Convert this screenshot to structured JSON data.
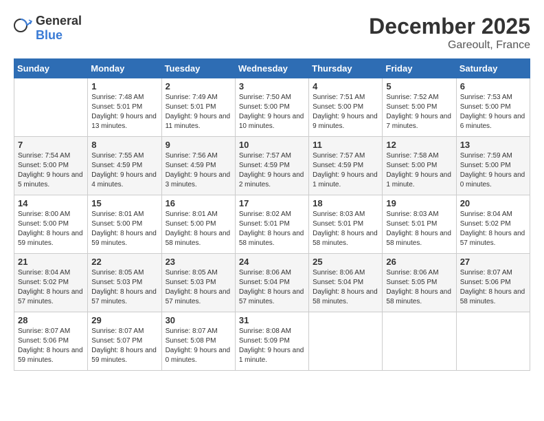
{
  "header": {
    "logo_general": "General",
    "logo_blue": "Blue",
    "month": "December 2025",
    "location": "Gareoult, France"
  },
  "days_of_week": [
    "Sunday",
    "Monday",
    "Tuesday",
    "Wednesday",
    "Thursday",
    "Friday",
    "Saturday"
  ],
  "weeks": [
    [
      {
        "day": "",
        "empty": true
      },
      {
        "day": "1",
        "sunrise": "7:48 AM",
        "sunset": "5:01 PM",
        "daylight": "9 hours and 13 minutes."
      },
      {
        "day": "2",
        "sunrise": "7:49 AM",
        "sunset": "5:01 PM",
        "daylight": "9 hours and 11 minutes."
      },
      {
        "day": "3",
        "sunrise": "7:50 AM",
        "sunset": "5:00 PM",
        "daylight": "9 hours and 10 minutes."
      },
      {
        "day": "4",
        "sunrise": "7:51 AM",
        "sunset": "5:00 PM",
        "daylight": "9 hours and 9 minutes."
      },
      {
        "day": "5",
        "sunrise": "7:52 AM",
        "sunset": "5:00 PM",
        "daylight": "9 hours and 7 minutes."
      },
      {
        "day": "6",
        "sunrise": "7:53 AM",
        "sunset": "5:00 PM",
        "daylight": "9 hours and 6 minutes."
      }
    ],
    [
      {
        "day": "7",
        "sunrise": "7:54 AM",
        "sunset": "5:00 PM",
        "daylight": "9 hours and 5 minutes."
      },
      {
        "day": "8",
        "sunrise": "7:55 AM",
        "sunset": "4:59 PM",
        "daylight": "9 hours and 4 minutes."
      },
      {
        "day": "9",
        "sunrise": "7:56 AM",
        "sunset": "4:59 PM",
        "daylight": "9 hours and 3 minutes."
      },
      {
        "day": "10",
        "sunrise": "7:57 AM",
        "sunset": "4:59 PM",
        "daylight": "9 hours and 2 minutes."
      },
      {
        "day": "11",
        "sunrise": "7:57 AM",
        "sunset": "4:59 PM",
        "daylight": "9 hours and 1 minute."
      },
      {
        "day": "12",
        "sunrise": "7:58 AM",
        "sunset": "5:00 PM",
        "daylight": "9 hours and 1 minute."
      },
      {
        "day": "13",
        "sunrise": "7:59 AM",
        "sunset": "5:00 PM",
        "daylight": "9 hours and 0 minutes."
      }
    ],
    [
      {
        "day": "14",
        "sunrise": "8:00 AM",
        "sunset": "5:00 PM",
        "daylight": "8 hours and 59 minutes."
      },
      {
        "day": "15",
        "sunrise": "8:01 AM",
        "sunset": "5:00 PM",
        "daylight": "8 hours and 59 minutes."
      },
      {
        "day": "16",
        "sunrise": "8:01 AM",
        "sunset": "5:00 PM",
        "daylight": "8 hours and 58 minutes."
      },
      {
        "day": "17",
        "sunrise": "8:02 AM",
        "sunset": "5:01 PM",
        "daylight": "8 hours and 58 minutes."
      },
      {
        "day": "18",
        "sunrise": "8:03 AM",
        "sunset": "5:01 PM",
        "daylight": "8 hours and 58 minutes."
      },
      {
        "day": "19",
        "sunrise": "8:03 AM",
        "sunset": "5:01 PM",
        "daylight": "8 hours and 58 minutes."
      },
      {
        "day": "20",
        "sunrise": "8:04 AM",
        "sunset": "5:02 PM",
        "daylight": "8 hours and 57 minutes."
      }
    ],
    [
      {
        "day": "21",
        "sunrise": "8:04 AM",
        "sunset": "5:02 PM",
        "daylight": "8 hours and 57 minutes."
      },
      {
        "day": "22",
        "sunrise": "8:05 AM",
        "sunset": "5:03 PM",
        "daylight": "8 hours and 57 minutes."
      },
      {
        "day": "23",
        "sunrise": "8:05 AM",
        "sunset": "5:03 PM",
        "daylight": "8 hours and 57 minutes."
      },
      {
        "day": "24",
        "sunrise": "8:06 AM",
        "sunset": "5:04 PM",
        "daylight": "8 hours and 57 minutes."
      },
      {
        "day": "25",
        "sunrise": "8:06 AM",
        "sunset": "5:04 PM",
        "daylight": "8 hours and 58 minutes."
      },
      {
        "day": "26",
        "sunrise": "8:06 AM",
        "sunset": "5:05 PM",
        "daylight": "8 hours and 58 minutes."
      },
      {
        "day": "27",
        "sunrise": "8:07 AM",
        "sunset": "5:06 PM",
        "daylight": "8 hours and 58 minutes."
      }
    ],
    [
      {
        "day": "28",
        "sunrise": "8:07 AM",
        "sunset": "5:06 PM",
        "daylight": "8 hours and 59 minutes."
      },
      {
        "day": "29",
        "sunrise": "8:07 AM",
        "sunset": "5:07 PM",
        "daylight": "8 hours and 59 minutes."
      },
      {
        "day": "30",
        "sunrise": "8:07 AM",
        "sunset": "5:08 PM",
        "daylight": "9 hours and 0 minutes."
      },
      {
        "day": "31",
        "sunrise": "8:08 AM",
        "sunset": "5:09 PM",
        "daylight": "9 hours and 1 minute."
      },
      {
        "day": "",
        "empty": true
      },
      {
        "day": "",
        "empty": true
      },
      {
        "day": "",
        "empty": true
      }
    ]
  ]
}
